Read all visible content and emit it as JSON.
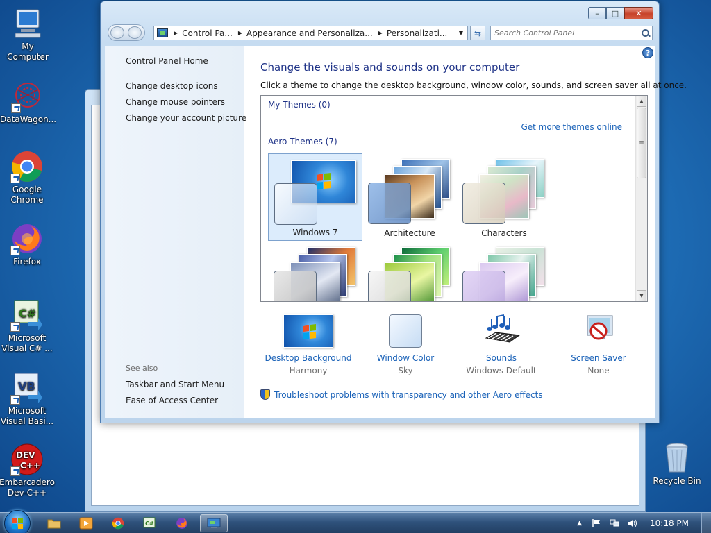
{
  "desktop": {
    "icons": [
      {
        "label": "My Computer"
      },
      {
        "label": "DataWagon..."
      },
      {
        "label": "Google Chrome"
      },
      {
        "label": "Firefox"
      },
      {
        "label": "Microsoft Visual C# ..."
      },
      {
        "label": "Microsoft Visual Basi..."
      },
      {
        "label": "Embarcadero Dev-C++"
      },
      {
        "label": "Recycle Bin"
      }
    ]
  },
  "window": {
    "caption": {
      "minimize": "–",
      "maximize": "□",
      "close": "✕"
    },
    "address": {
      "crumbs": [
        "Control Pa...",
        "Appearance and Personaliza...",
        "Personalizati..."
      ]
    },
    "search": {
      "placeholder": "Search Control Panel"
    },
    "help": "?"
  },
  "sidebar": {
    "home": "Control Panel Home",
    "links": [
      "Change desktop icons",
      "Change mouse pointers",
      "Change your account picture"
    ],
    "see_also_title": "See also",
    "see_also": [
      "Taskbar and Start Menu",
      "Ease of Access Center"
    ]
  },
  "main": {
    "heading": "Change the visuals and sounds on your computer",
    "description": "Click a theme to change the desktop background, window color, sounds, and screen saver all at once.",
    "my_themes": "My Themes (0)",
    "get_more": "Get more themes online",
    "aero_themes": "Aero Themes (7)",
    "themes": [
      {
        "name": "Windows 7",
        "selected": true
      },
      {
        "name": "Architecture",
        "selected": false
      },
      {
        "name": "Characters",
        "selected": false
      },
      {
        "name": "",
        "selected": false
      },
      {
        "name": "",
        "selected": false
      },
      {
        "name": "",
        "selected": false
      }
    ],
    "settings": [
      {
        "link": "Desktop Background",
        "value": "Harmony"
      },
      {
        "link": "Window Color",
        "value": "Sky"
      },
      {
        "link": "Sounds",
        "value": "Windows Default"
      },
      {
        "link": "Screen Saver",
        "value": "None"
      }
    ],
    "troubleshoot": "Troubleshoot problems with transparency and other Aero effects"
  },
  "taskbar": {
    "pinned": [
      "explorer-icon",
      "media-player-icon",
      "chrome-icon",
      "visual-csharp-icon",
      "firefox-icon",
      "control-panel-icon"
    ],
    "clock": "10:18 PM"
  }
}
